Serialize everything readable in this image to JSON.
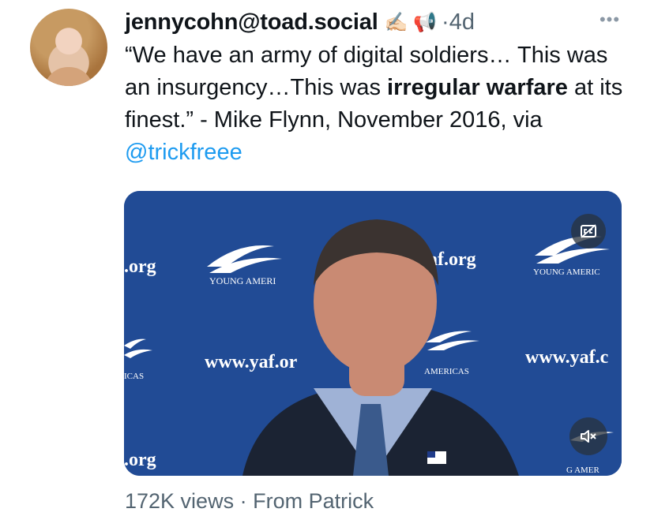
{
  "post": {
    "handle": "jennycohn@toad.social",
    "emoji": "✍🏻 📢",
    "separator": "·",
    "time": "4d",
    "more_icon": "more-horizontal-icon",
    "text_part1": "“We have an army of digital soldiers… This was an insurgency…This was ",
    "text_bold": "irregular warfare",
    "text_part2": " at its finest.” - Mike Flynn, November 2016, via ",
    "mention": "@trickfreee"
  },
  "media": {
    "backdrop_text": {
      "org_left": ".org",
      "young_america_1": "YOUNG AMERI",
      "yaf_org_center": "af.org",
      "young_america_2": "YOUNG AMERIC",
      "www_left": "www.yaf.or",
      "www_right": "www.yaf.c",
      "americas_left": "ICAS",
      "americas_center": "AMERICAS",
      "org_bottom": ".org",
      "young_america_3": "G AMER"
    },
    "cc_icon": "closed-captions-icon",
    "mute_icon": "volume-muted-icon"
  },
  "footer": {
    "views": "172K views",
    "separator": "·",
    "source": "From Patrick"
  },
  "colors": {
    "link": "#1d9bf0",
    "muted": "#536471",
    "backdrop": "#234b92"
  }
}
